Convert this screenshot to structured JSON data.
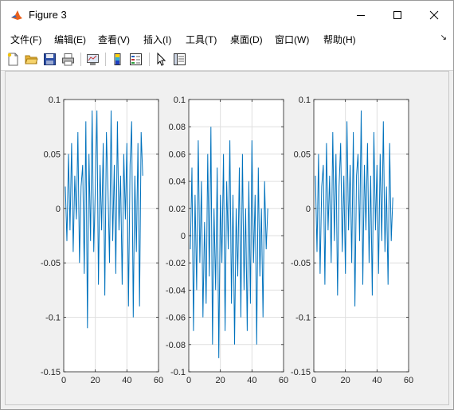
{
  "window": {
    "title": "Figure 3",
    "app_icon": "matlab-icon",
    "controls": [
      "minimize-icon",
      "maximize-icon",
      "close-icon"
    ]
  },
  "menu": {
    "items": [
      {
        "label": "文件(F)"
      },
      {
        "label": "编辑(E)"
      },
      {
        "label": "查看(V)"
      },
      {
        "label": "插入(I)"
      },
      {
        "label": "工具(T)"
      },
      {
        "label": "桌面(D)"
      },
      {
        "label": "窗口(W)"
      },
      {
        "label": "帮助(H)"
      }
    ],
    "overflow_icon": "dock-arrow-icon"
  },
  "toolbar": {
    "icons": [
      "new-figure-icon",
      "open-file-icon",
      "save-icon",
      "print-icon",
      "link-plot-icon",
      "colorbar-icon",
      "legend-icon",
      "edit-plot-icon",
      "property-inspector-icon"
    ]
  },
  "chart_data": [
    {
      "type": "line",
      "color": "#0072BD",
      "grid": true,
      "xlim": [
        0,
        60
      ],
      "ylim": [
        -0.15,
        0.1
      ],
      "xticks": [
        "0",
        "20",
        "40",
        "60"
      ],
      "yticks": [
        "0.1",
        "0.05",
        "0",
        "-0.05",
        "-0.1",
        "-0.15"
      ],
      "series": [
        {
          "x": [
            1,
            2,
            3,
            4,
            5,
            6,
            7,
            8,
            9,
            10,
            11,
            12,
            13,
            14,
            15,
            16,
            17,
            18,
            19,
            20,
            21,
            22,
            23,
            24,
            25,
            26,
            27,
            28,
            29,
            30,
            31,
            32,
            33,
            34,
            35,
            36,
            37,
            38,
            39,
            40,
            41,
            42,
            43,
            44,
            45,
            46,
            47,
            48,
            49,
            50
          ],
          "values": [
            0.02,
            -0.03,
            0.05,
            -0.02,
            0.06,
            -0.04,
            0.03,
            -0.01,
            0.07,
            -0.05,
            0.02,
            0.04,
            -0.06,
            0.08,
            -0.11,
            0.05,
            -0.03,
            0.09,
            -0.04,
            0.02,
            0.09,
            -0.07,
            0.04,
            -0.02,
            0.06,
            -0.08,
            0.07,
            0.02,
            -0.05,
            0.09,
            -0.03,
            0.04,
            -0.06,
            0.08,
            -0.02,
            0.03,
            -0.07,
            0.05,
            -0.01,
            0.06,
            -0.09,
            0.04,
            0.08,
            -0.1,
            0.03,
            -0.04,
            0.06,
            -0.09,
            0.07,
            0.03
          ]
        }
      ]
    },
    {
      "type": "line",
      "color": "#0072BD",
      "grid": true,
      "xlim": [
        0,
        60
      ],
      "ylim": [
        -0.1,
        0.1
      ],
      "xticks": [
        "0",
        "20",
        "40",
        "60"
      ],
      "yticks": [
        "0.1",
        "0.08",
        "0.06",
        "0.04",
        "0.02",
        "0",
        "-0.02",
        "-0.04",
        "-0.06",
        "-0.08",
        "-0.1"
      ],
      "series": [
        {
          "x": [
            1,
            2,
            3,
            4,
            5,
            6,
            7,
            8,
            9,
            10,
            11,
            12,
            13,
            14,
            15,
            16,
            17,
            18,
            19,
            20,
            21,
            22,
            23,
            24,
            25,
            26,
            27,
            28,
            29,
            30,
            31,
            32,
            33,
            34,
            35,
            36,
            37,
            38,
            39,
            40,
            41,
            42,
            43,
            44,
            45,
            46,
            47,
            48,
            49,
            50
          ],
          "values": [
            -0.01,
            0.05,
            -0.07,
            0.03,
            -0.04,
            0.07,
            -0.02,
            0.04,
            -0.06,
            0.01,
            -0.05,
            0.06,
            -0.03,
            0.08,
            -0.08,
            0.02,
            -0.04,
            0.05,
            -0.09,
            0.03,
            -0.02,
            0.06,
            -0.07,
            0.04,
            -0.01,
            0.07,
            -0.05,
            0.03,
            -0.08,
            0.02,
            -0.03,
            0.05,
            -0.06,
            0.06,
            -0.04,
            0.02,
            -0.07,
            0.04,
            -0.05,
            0.07,
            -0.02,
            0.03,
            -0.08,
            0.05,
            -0.03,
            0.02,
            -0.06,
            0.04,
            -0.01,
            0.02
          ]
        }
      ]
    },
    {
      "type": "line",
      "color": "#0072BD",
      "grid": true,
      "xlim": [
        0,
        60
      ],
      "ylim": [
        -0.15,
        0.1
      ],
      "xticks": [
        "0",
        "20",
        "40",
        "60"
      ],
      "yticks": [
        "0.1",
        "0.05",
        "0",
        "-0.05",
        "-0.1",
        "-0.15"
      ],
      "series": [
        {
          "x": [
            1,
            2,
            3,
            4,
            5,
            6,
            7,
            8,
            9,
            10,
            11,
            12,
            13,
            14,
            15,
            16,
            17,
            18,
            19,
            20,
            21,
            22,
            23,
            24,
            25,
            26,
            27,
            28,
            29,
            30,
            31,
            32,
            33,
            34,
            35,
            36,
            37,
            38,
            39,
            40,
            41,
            42,
            43,
            44,
            45,
            46,
            47,
            48,
            49,
            50
          ],
          "values": [
            0.03,
            -0.04,
            0.05,
            -0.06,
            0.02,
            0.04,
            -0.07,
            0.06,
            -0.02,
            0.03,
            -0.05,
            0.07,
            -0.03,
            0.05,
            -0.08,
            0.02,
            0.06,
            -0.04,
            0.03,
            -0.06,
            0.08,
            -0.02,
            0.04,
            -0.05,
            0.07,
            -0.09,
            0.03,
            0.05,
            -0.03,
            0.09,
            -0.07,
            0.04,
            -0.02,
            0.06,
            -0.05,
            0.03,
            -0.08,
            0.07,
            -0.02,
            0.04,
            -0.06,
            0.05,
            -0.03,
            0.08,
            -0.04,
            0.02,
            -0.07,
            0.06,
            -0.03,
            0.01
          ]
        }
      ]
    }
  ]
}
